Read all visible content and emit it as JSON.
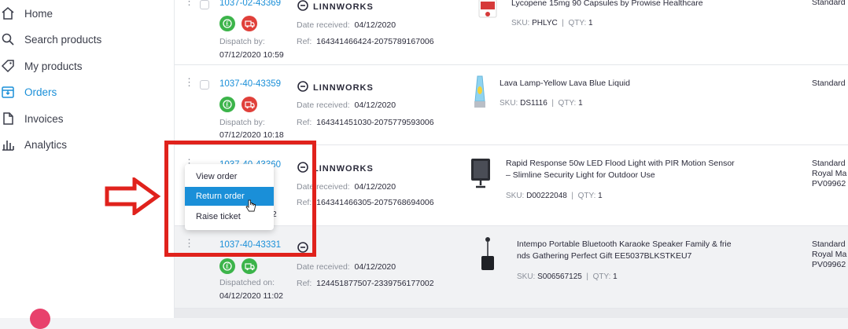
{
  "sidebar": {
    "items": [
      {
        "label": "Home",
        "icon": "home-icon"
      },
      {
        "label": "Search products",
        "icon": "search-icon"
      },
      {
        "label": "My products",
        "icon": "tag-icon"
      },
      {
        "label": "Orders",
        "icon": "orders-icon",
        "active": true
      },
      {
        "label": "Invoices",
        "icon": "document-icon"
      },
      {
        "label": "Analytics",
        "icon": "bar-chart-icon"
      }
    ]
  },
  "brand": {
    "name": "LINNWORKS"
  },
  "colors": {
    "accent": "#1a8fd8",
    "green": "#3cb44a",
    "red": "#e0403a",
    "annotation": "#e0221c"
  },
  "orders": [
    {
      "number": "1037-02-43369",
      "date_label": "Dispatch by:",
      "date_value": "07/12/2020 10:59",
      "received_label": "Date received:",
      "received_value": "04/12/2020",
      "ref_label": "Ref:",
      "ref_value": "164341466424-2075789167006",
      "product_title": "Lycopene 15mg 90 Capsules by Prowise Healthcare",
      "sku_label": "SKU:",
      "sku_value": "PHLYC",
      "qty_label": "QTY:",
      "qty_value": "1",
      "shipping": [
        "Standard"
      ]
    },
    {
      "number": "1037-40-43359",
      "date_label": "Dispatch by:",
      "date_value": "07/12/2020 10:18",
      "received_label": "Date received:",
      "received_value": "04/12/2020",
      "ref_label": "Ref:",
      "ref_value": "164341451030-2075779593006",
      "product_title": "Lava Lamp-Yellow Lava Blue Liquid",
      "sku_label": "SKU:",
      "sku_value": "DS1116",
      "qty_label": "QTY:",
      "qty_value": "1",
      "shipping": [
        "Standard"
      ]
    },
    {
      "number": "1037-40-43360",
      "date_value_partial": "02",
      "received_label": "Date received:",
      "received_value": "04/12/2020",
      "ref_label": "Ref:",
      "ref_value": "164341466305-2075768694006",
      "product_title_1": "Rapid Response 50w LED Flood Light with PIR Motion Sensor",
      "product_title_2": "– Slimline Security Light for Outdoor Use",
      "sku_label": "SKU:",
      "sku_value": "D00222048",
      "qty_label": "QTY:",
      "qty_value": "1",
      "shipping": [
        "Standard",
        "Royal Ma",
        "PV09962"
      ]
    },
    {
      "number": "1037-40-43331",
      "date_label": "Dispatched on:",
      "date_value": "04/12/2020 11:02",
      "received_label": "Date received:",
      "received_value": "04/12/2020",
      "ref_label": "Ref:",
      "ref_value": "124451877507-2339756177002",
      "product_title_1": "Intempo Portable Bluetooth Karaoke Speaker Family & frie",
      "product_title_2": "nds Gathering Perfect Gift EE5037BLKSTKEU7",
      "sku_label": "SKU:",
      "sku_value": "S006567125",
      "qty_label": "QTY:",
      "qty_value": "1",
      "shipping": [
        "Standard",
        "Royal Ma",
        "PV09962"
      ]
    }
  ],
  "context_menu": {
    "items": [
      "View order",
      "Return order",
      "Raise ticket"
    ],
    "highlighted": "Return order"
  }
}
